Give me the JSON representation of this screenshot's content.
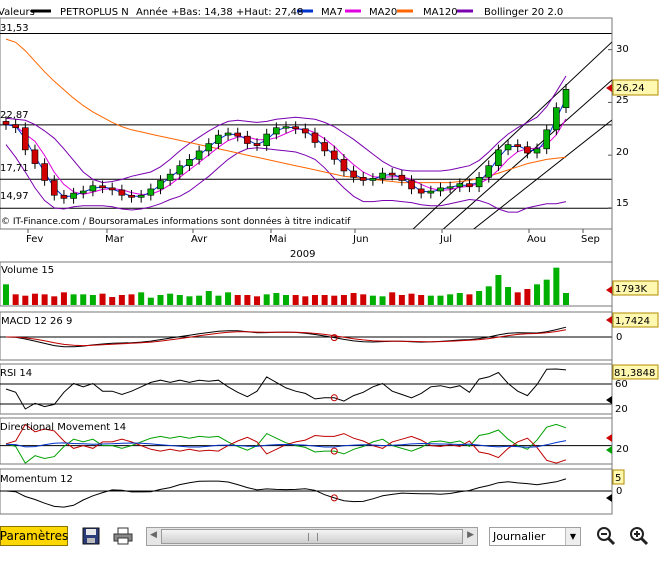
{
  "header": {
    "valeurs": "Valeurs",
    "symbol": "PETROPLUS N",
    "range": "Année +Bas: 14,38 +Haut: 27,48",
    "legend": [
      {
        "label": "MA7",
        "color": "#0033cc"
      },
      {
        "label": "MA20",
        "color": "#e000e0"
      },
      {
        "label": "MA120",
        "color": "#ff6600"
      },
      {
        "label": "Bollinger 20 2.0",
        "color": "#7a00b0"
      }
    ]
  },
  "price_panel": {
    "credit": "© IT-Finance.com / BoursoramaLes informations sont données à titre indicatif",
    "left_levels": [
      "31,53",
      "22,87",
      "17,71",
      "14,97"
    ],
    "right_ticks": [
      "30",
      "25",
      "20",
      "15"
    ],
    "last_price": "26,24",
    "x_labels": [
      "Fev",
      "Mar",
      "Avr",
      "Mai",
      "Jun",
      "Jul",
      "Aou",
      "Sep"
    ],
    "year": "2009"
  },
  "indicators": {
    "volume": {
      "title": "Volume 15",
      "value": "1793K"
    },
    "macd": {
      "title": "MACD 12 26 9",
      "value": "1,7424",
      "tick": "0"
    },
    "rsi": {
      "title": "RSI 14",
      "value": "81,3848",
      "ticks": [
        "60",
        "20"
      ]
    },
    "dm": {
      "title": "Directional Movement 14",
      "tick": "20"
    },
    "momentum": {
      "title": "Momentum 12",
      "value": "5",
      "tick": "0"
    }
  },
  "toolbar": {
    "params_label": "Paramètres",
    "period_value": "Journalier"
  },
  "chart_data": {
    "type": "line",
    "title": "PETROPLUS N",
    "x_range": [
      "2009-01-20",
      "2009-08-21"
    ],
    "y_range": [
      13,
      33
    ],
    "close": [
      22.9,
      22.6,
      20.5,
      19.2,
      17.6,
      16.2,
      15.9,
      16.4,
      16.6,
      17.1,
      16.9,
      16.7,
      16.2,
      16.0,
      16.2,
      16.8,
      17.6,
      18.2,
      19.0,
      19.6,
      20.4,
      21.1,
      21.9,
      22.1,
      21.8,
      21.1,
      20.9,
      22.0,
      22.6,
      22.7,
      22.5,
      22.1,
      21.2,
      20.4,
      19.6,
      18.5,
      17.9,
      17.6,
      17.8,
      18.3,
      18.1,
      17.6,
      16.8,
      16.4,
      16.6,
      16.9,
      17.0,
      17.3,
      17.0,
      17.9,
      19.0,
      20.5,
      21.0,
      20.8,
      20.2,
      20.6,
      22.4,
      24.5,
      26.24
    ],
    "ma120": [
      31.0,
      30.7,
      29.9,
      28.9,
      27.9,
      27.0,
      26.2,
      25.4,
      24.7,
      24.1,
      23.6,
      23.1,
      22.7,
      22.4,
      22.2,
      22.0,
      21.8,
      21.6,
      21.4,
      21.2,
      21.0,
      20.8,
      20.6,
      20.4,
      20.2,
      20.0,
      19.8,
      19.6,
      19.4,
      19.2,
      19.0,
      18.8,
      18.6,
      18.4,
      18.2,
      18.0,
      17.9,
      17.8,
      17.7,
      17.6,
      17.5,
      17.4,
      17.4,
      17.4,
      17.4,
      17.4,
      17.4,
      17.5,
      17.6,
      17.8,
      18.0,
      18.3,
      18.6,
      18.9,
      19.2,
      19.4,
      19.6,
      19.7,
      19.8
    ],
    "bb_upper": [
      23.5,
      23.4,
      23.3,
      22.9,
      22.3,
      21.6,
      20.6,
      19.5,
      18.4,
      17.7,
      17.4,
      17.5,
      17.7,
      18.0,
      18.2,
      18.4,
      18.9,
      19.6,
      20.4,
      21.1,
      21.7,
      22.3,
      22.8,
      23.2,
      23.3,
      23.2,
      23.1,
      23.2,
      23.4,
      23.5,
      23.6,
      23.5,
      23.4,
      23.1,
      22.7,
      22.1,
      21.5,
      20.8,
      20.1,
      19.4,
      18.9,
      18.6,
      18.5,
      18.5,
      18.5,
      18.5,
      18.6,
      18.8,
      19.0,
      19.5,
      20.3,
      21.2,
      22.0,
      22.6,
      23.1,
      23.6,
      24.6,
      26.0,
      27.5
    ],
    "bb_lower": [
      21.0,
      19.8,
      18.4,
      16.9,
      15.7,
      15.0,
      14.9,
      15.1,
      15.2,
      15.2,
      15.2,
      15.1,
      14.9,
      14.8,
      14.9,
      15.1,
      15.4,
      15.8,
      16.1,
      16.6,
      17.3,
      18.0,
      18.8,
      19.6,
      20.2,
      20.6,
      20.7,
      20.6,
      20.5,
      20.4,
      20.3,
      20.0,
      19.6,
      18.8,
      17.8,
      16.9,
      16.1,
      15.6,
      15.6,
      15.7,
      15.7,
      15.6,
      15.5,
      15.3,
      15.2,
      15.2,
      15.4,
      15.6,
      15.8,
      15.7,
      15.4,
      14.9,
      14.6,
      14.6,
      15.0,
      15.2,
      15.4,
      15.4,
      15.6
    ],
    "volume": [
      3.1,
      1.6,
      1.4,
      1.7,
      1.6,
      1.3,
      1.9,
      1.6,
      1.6,
      1.5,
      1.7,
      1.2,
      1.5,
      1.6,
      1.9,
      1.1,
      1.5,
      1.7,
      1.5,
      1.3,
      1.4,
      2.1,
      1.4,
      1.9,
      1.5,
      1.5,
      1.3,
      1.6,
      1.8,
      1.5,
      1.5,
      1.3,
      1.5,
      1.5,
      1.4,
      1.5,
      1.8,
      1.6,
      1.4,
      1.3,
      1.9,
      1.5,
      1.7,
      1.5,
      1.4,
      1.4,
      1.6,
      1.8,
      1.6,
      2.1,
      2.8,
      4.5,
      2.7,
      1.9,
      2.4,
      3.1,
      3.8,
      5.6,
      1.8
    ]
  }
}
